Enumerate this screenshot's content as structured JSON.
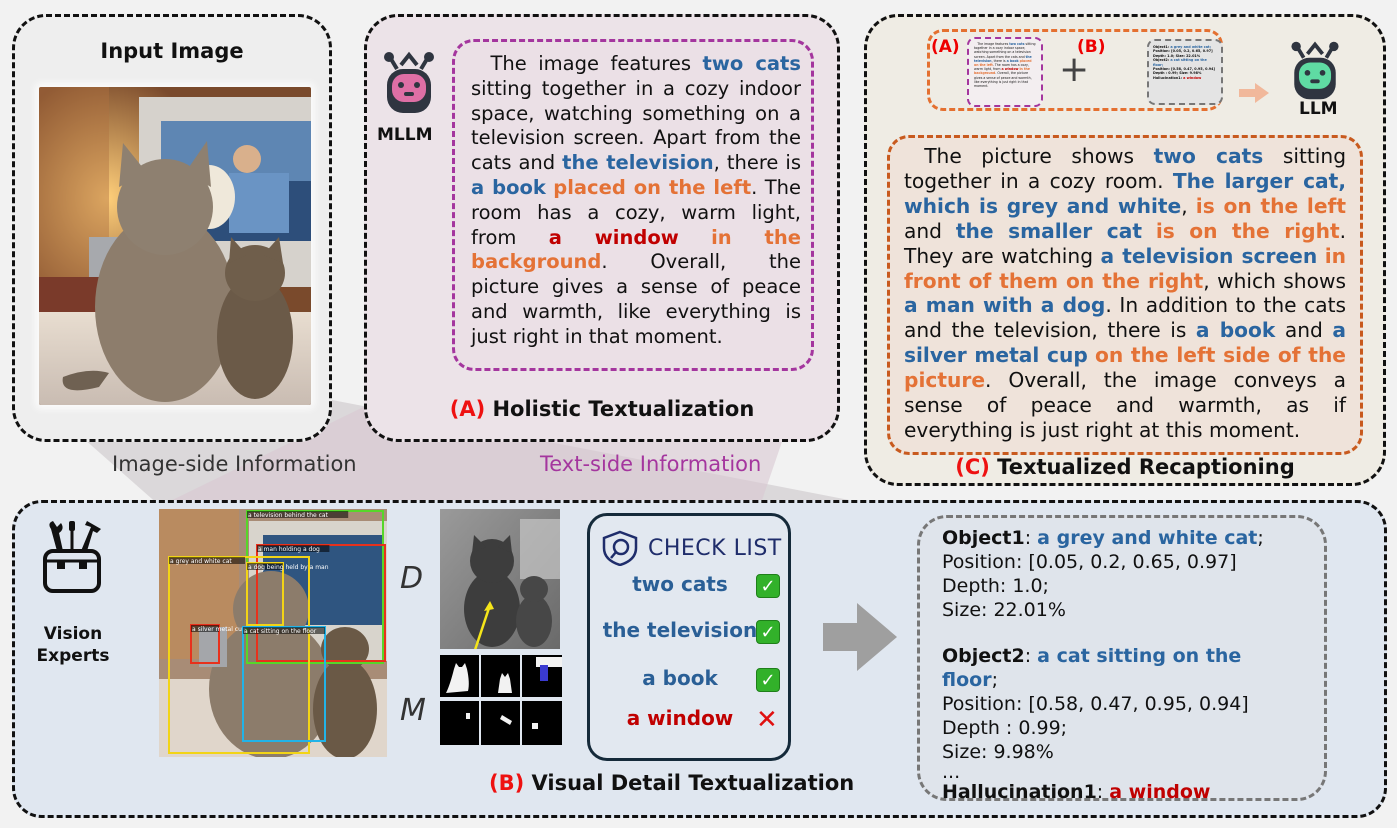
{
  "input_panel": {
    "title": "Input Image",
    "image_alt": "Two cats sitting in front of a television showing a man with a dog"
  },
  "panel_a": {
    "model_label": "MLLM",
    "model_icon": "robot-icon",
    "caption_tag": "(A)",
    "caption_text": " Holistic Textualization",
    "description": [
      {
        "t": "The image features ",
        "s": "plain"
      },
      {
        "t": "two cats",
        "s": "blue"
      },
      {
        "t": " sitting together in a cozy indoor space, watching something on a television screen. Apart from the cats and ",
        "s": "plain"
      },
      {
        "t": "the television",
        "s": "blue"
      },
      {
        "t": ", there is ",
        "s": "plain"
      },
      {
        "t": "a book",
        "s": "blue"
      },
      {
        "t": " ",
        "s": "plain"
      },
      {
        "t": "placed on the left",
        "s": "orange"
      },
      {
        "t": ". The room has a cozy, warm light, from ",
        "s": "plain"
      },
      {
        "t": "a window",
        "s": "red"
      },
      {
        "t": " ",
        "s": "plain"
      },
      {
        "t": "in the background",
        "s": "orange"
      },
      {
        "t": ". Overall, the picture gives a sense of peace and warmth, like everything is just right in that moment.",
        "s": "plain"
      }
    ]
  },
  "middle_labels": {
    "image_side": "Image-side Information",
    "text_side": "Text-side Information"
  },
  "panel_c": {
    "label_a": "(A)",
    "label_b": "(B)",
    "plus": "+",
    "model_label": "LLM",
    "model_icon": "robot-icon",
    "caption_tag": "(C)",
    "caption_text": " Textualized Recaptioning",
    "mini_b_lines": [
      {
        "k": "Object1: ",
        "v": "a grey and white cat;"
      },
      {
        "k": "Position: [0.05, 0.2, 0.65, 0.97]",
        "v": ""
      },
      {
        "k": "Depth: 1.0; Size: 22.01%",
        "v": ""
      },
      {
        "k": "Object2: ",
        "v": "a cat sitting on the floor;"
      },
      {
        "k": "Position: [0.58, 0.47, 0.95, 0.94]",
        "v": ""
      },
      {
        "k": "Depth : 0.99; Size: 9.98%",
        "v": ""
      },
      {
        "k": "Hallucination1: ",
        "v": "a window"
      }
    ],
    "recaption": [
      {
        "t": "The picture shows ",
        "s": "plain"
      },
      {
        "t": "two cats",
        "s": "blue"
      },
      {
        "t": " sitting together in a cozy room. ",
        "s": "plain"
      },
      {
        "t": "The larger cat, which is grey and white",
        "s": "blue"
      },
      {
        "t": ", ",
        "s": "plain"
      },
      {
        "t": "is on the left",
        "s": "orange"
      },
      {
        "t": " and ",
        "s": "plain"
      },
      {
        "t": "the smaller cat",
        "s": "blue"
      },
      {
        "t": " ",
        "s": "plain"
      },
      {
        "t": "is on the right",
        "s": "orange"
      },
      {
        "t": ". They are watching ",
        "s": "plain"
      },
      {
        "t": "a television screen",
        "s": "blue"
      },
      {
        "t": " ",
        "s": "plain"
      },
      {
        "t": "in front of them on the right",
        "s": "orange"
      },
      {
        "t": ", which shows ",
        "s": "plain"
      },
      {
        "t": "a man with a dog",
        "s": "blue"
      },
      {
        "t": ". In addition to the cats and the television, there is ",
        "s": "plain"
      },
      {
        "t": "a book",
        "s": "blue"
      },
      {
        "t": " and ",
        "s": "plain"
      },
      {
        "t": "a silver metal cup",
        "s": "blue"
      },
      {
        "t": " ",
        "s": "plain"
      },
      {
        "t": "on the left side of the picture",
        "s": "orange"
      },
      {
        "t": ". Overall, the image conveys a sense of peace and warmth, as if everything is just right at this moment.",
        "s": "plain"
      }
    ]
  },
  "panel_b": {
    "experts_label_1": "Vision",
    "experts_label_2": "Experts",
    "experts_icon": "toolbox-icon",
    "detections": [
      {
        "label": "a television behind the cat",
        "color": "#56d62a"
      },
      {
        "label": "a man holding a dog",
        "color": "#e8311c"
      },
      {
        "label": "a grey and white cat",
        "color": "#f2d416"
      },
      {
        "label": "a dog being held by a man",
        "color": "#f2d416"
      },
      {
        "label": "a silver metal cup",
        "color": "#e8311c"
      },
      {
        "label": "a cat sitting on the floor",
        "color": "#22b3e8"
      }
    ],
    "depth_label": "D",
    "mask_label": "M",
    "checklist": {
      "title": "CHECK LIST",
      "items": [
        {
          "label": "two cats",
          "status": "pass"
        },
        {
          "label": "the television",
          "status": "pass"
        },
        {
          "label": "a book",
          "status": "pass"
        },
        {
          "label": "a window",
          "status": "fail"
        }
      ]
    },
    "objects": [
      {
        "name_key": "Object1",
        "name_val": "a grey and white cat",
        "position": "Position: [0.05, 0.2, 0.65, 0.97]",
        "depth": "Depth: 1.0;",
        "size": "Size: 22.01%"
      },
      {
        "name_key": "Object2",
        "name_val": "a cat sitting on the floor",
        "position": "Position: [0.58, 0.47, 0.95, 0.94]",
        "depth": "Depth : 0.99;",
        "size": "Size: 9.98%"
      }
    ],
    "ellipsis": "...",
    "hallucination_key": "Hallucination1",
    "hallucination_val": "a window",
    "caption_tag": "(B)",
    "caption_text": " Visual Detail Textualization"
  },
  "colors": {
    "blue": "#2a65a0",
    "orange": "#e47236",
    "red": "#c00000",
    "purple": "#a4369e",
    "check_green": "#32b12a"
  }
}
